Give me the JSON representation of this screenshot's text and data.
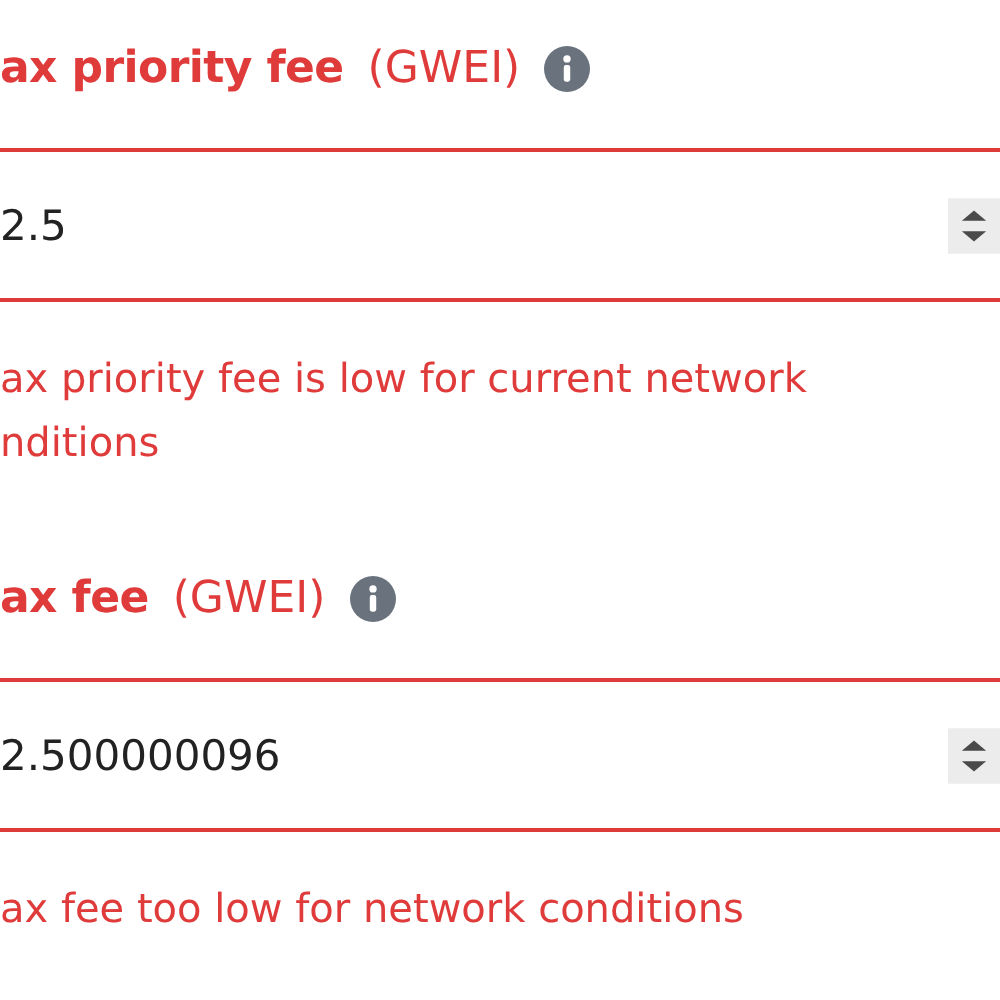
{
  "fields": [
    {
      "label": "ax priority fee",
      "unit": "(GWEI)",
      "value": "2.5",
      "error": true,
      "message": "ax priority fee is low for current network\nnditions"
    },
    {
      "label": "ax fee",
      "unit": "(GWEI)",
      "value": "2.500000096",
      "error": true,
      "message": "ax fee too low for network conditions"
    }
  ]
}
